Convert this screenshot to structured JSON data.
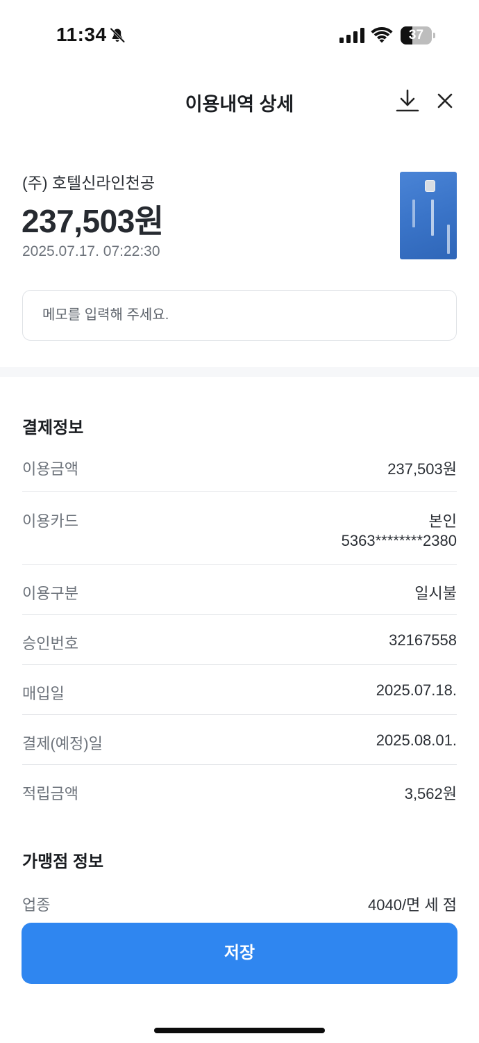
{
  "status_bar": {
    "time": "11:34",
    "battery_level": "37",
    "battery_fraction": 0.37
  },
  "header": {
    "title": "이용내역 상세"
  },
  "summary": {
    "merchant": "(주) 호텔신라인천공",
    "amount": "237,503원",
    "datetime": "2025.07.17. 07:22:30",
    "card_color": "#3a74c8"
  },
  "memo": {
    "placeholder": "메모를 입력해 주세요.",
    "value": ""
  },
  "payment_info": {
    "title": "결제정보",
    "rows": [
      {
        "label": "이용금액",
        "value": "237,503원"
      },
      {
        "label": "이용카드",
        "value": "본인",
        "value2": "5363********2380"
      },
      {
        "label": "이용구분",
        "value": "일시불"
      },
      {
        "label": "승인번호",
        "value": "32167558"
      },
      {
        "label": "매입일",
        "value": "2025.07.18."
      },
      {
        "label": "결제(예정)일",
        "value": "2025.08.01."
      },
      {
        "label": "적립금액",
        "value": "3,562원"
      }
    ]
  },
  "store_info": {
    "title": "가맹점 정보",
    "rows": [
      {
        "label": "업종",
        "value": "4040/면 세 점"
      }
    ]
  },
  "save_button": {
    "label": "저장",
    "color": "#2f86f0"
  },
  "icons": [
    "bell-off-icon",
    "signal-icon",
    "wifi-icon",
    "battery-icon",
    "download-icon",
    "close-icon"
  ]
}
